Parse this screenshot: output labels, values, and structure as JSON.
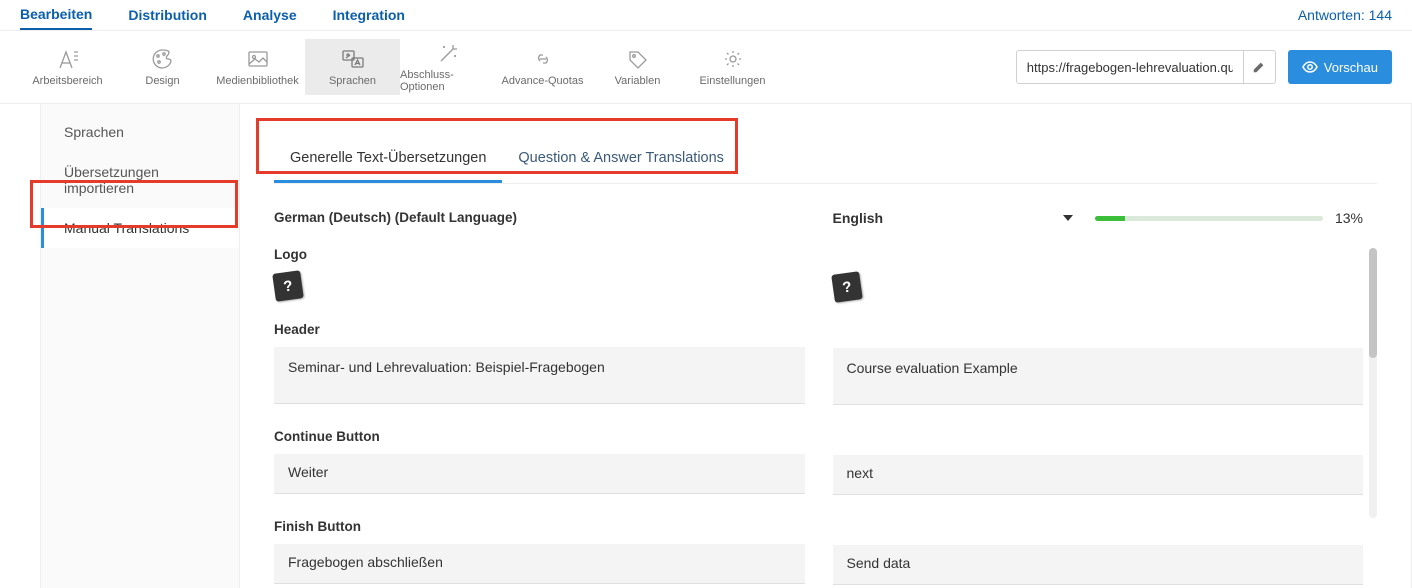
{
  "topnav": {
    "items": [
      "Bearbeiten",
      "Distribution",
      "Analyse",
      "Integration"
    ],
    "answers_label": "Antworten: 144"
  },
  "toolbar": {
    "items": [
      {
        "label": "Arbeitsbereich"
      },
      {
        "label": "Design"
      },
      {
        "label": "Medienbibliothek"
      },
      {
        "label": "Sprachen"
      },
      {
        "label": "Abschluss-Optionen"
      },
      {
        "label": "Advance-Quotas"
      },
      {
        "label": "Variablen"
      },
      {
        "label": "Einstellungen"
      }
    ],
    "url_value": "https://fragebogen-lehrevaluation.quest",
    "preview_label": "Vorschau"
  },
  "sidebar": {
    "items": [
      "Sprachen",
      "Übersetzungen importieren",
      "Manual Translations"
    ]
  },
  "tabs": {
    "items": [
      "Generelle Text-Übersetzungen",
      "Question & Answer Translations"
    ]
  },
  "left_col": {
    "default_label": "German (Deutsch) (Default Language)",
    "sections": {
      "logo_label": "Logo",
      "header_label": "Header",
      "header_value": "Seminar- und Lehrevaluation: Beispiel-Fragebogen",
      "continue_label": "Continue Button",
      "continue_value": "Weiter",
      "finish_label": "Finish Button",
      "finish_value": "Fragebogen abschließen"
    }
  },
  "right_col": {
    "language": "English",
    "progress_pct": "13%",
    "header_value": "Course evaluation Example",
    "continue_value": "next",
    "finish_value": "Send data"
  }
}
